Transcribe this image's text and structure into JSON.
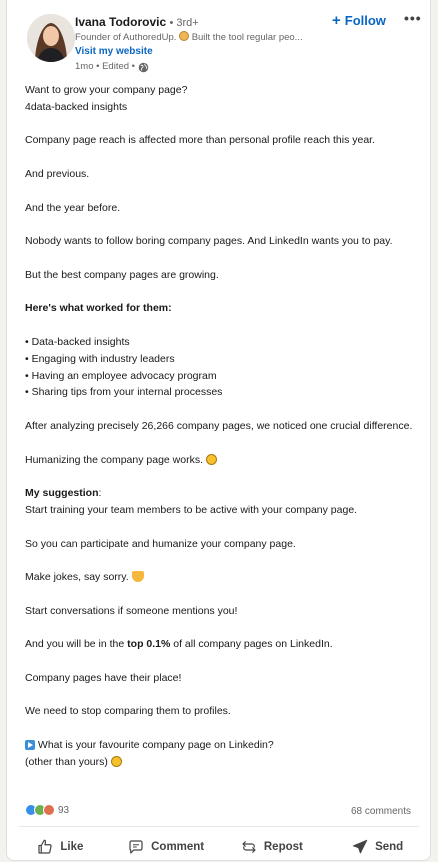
{
  "post": {
    "author_name": "Ivana Todorovic",
    "degree": "• 3rd+",
    "headline_prefix": "Founder of AuthoredUp.",
    "headline_suffix": "Built the tool regular peo...",
    "website_link": "Visit my website",
    "timestamp": "1mo • Edited •",
    "follow_label": "Follow",
    "more_label": "•••"
  },
  "content": {
    "p1a": "Want to grow your company page?",
    "p1b": "4data-backed insights",
    "p2": "Company page reach is affected more than personal profile reach this year.",
    "p3": "And previous.",
    "p4": "And the year before.",
    "p5": "Nobody wants to follow boring company pages. And LinkedIn wants you to pay.",
    "p6": "But the best company pages are growing.",
    "p7": "Here's what worked for them:",
    "bullets": [
      "• Data-backed insights",
      "• Engaging with industry leaders",
      "• Having an employee advocacy program",
      "• Sharing tips from your internal processes"
    ],
    "p8": "After analyzing precisely 26,266 company pages, we noticed one crucial difference.",
    "p9": "Humanizing the company page works.",
    "p10_bold": "My suggestion",
    "p10_colon": ":",
    "p10b": "Start training your team members to be active with your company page.",
    "p11": "So you can participate and humanize your company page.",
    "p12": "Make jokes, say sorry.",
    "p13": "Start conversations if someone mentions you!",
    "p14_pre": "And you will be in the ",
    "p14_bold": "top 0.1%",
    "p14_post": " of all company pages on LinkedIn.",
    "p15": "Company pages have their place!",
    "p16": "We need to stop comparing them to profiles.",
    "p17a": "What is your favourite company page on Linkedin?",
    "p17b": "(other than yours)"
  },
  "social": {
    "reaction_count": "93",
    "comments": "68 comments"
  },
  "actions": {
    "like": "Like",
    "comment": "Comment",
    "repost": "Repost",
    "send": "Send"
  },
  "colors": {
    "link": "#0a66c2",
    "text": "#191919",
    "muted": "#666666"
  }
}
